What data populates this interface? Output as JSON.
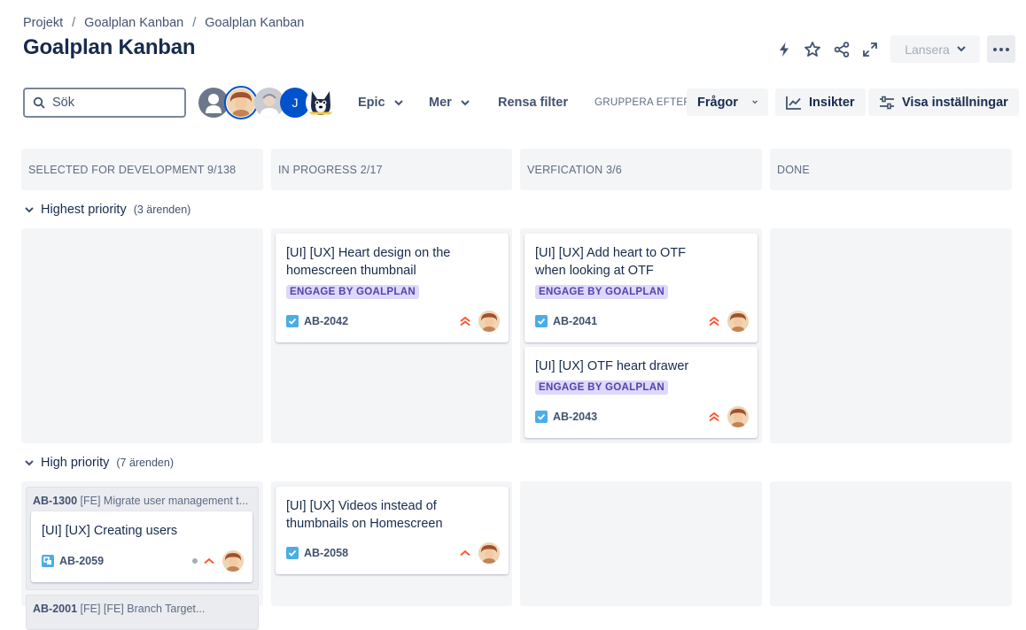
{
  "breadcrumb": [
    "Projekt",
    "Goalplan Kanban",
    "Goalplan Kanban"
  ],
  "title": "Goalplan Kanban",
  "header": {
    "release_label": "Lansera"
  },
  "toolbar": {
    "search_placeholder": "Sök",
    "avatar_j": "J",
    "epic_label": "Epic",
    "more_label": "Mer",
    "clear_filter": "Rensa filter",
    "group_by_label": "GRUPPERA EFTER",
    "group_by_value": "Frågor",
    "insights_label": "Insikter",
    "settings_label": "Visa inställningar"
  },
  "columns": [
    {
      "label": "SELECTED FOR DEVELOPMENT 9/138"
    },
    {
      "label": "IN PROGRESS 2/17"
    },
    {
      "label": "VERFICATION 3/6"
    },
    {
      "label": "DONE"
    }
  ],
  "swimlanes": [
    {
      "label": "Highest priority",
      "count": "(3 ärenden)"
    },
    {
      "label": "High priority",
      "count": "(7 ärenden)"
    }
  ],
  "cards": {
    "ab2042": {
      "title": "[UI] [UX] Heart design on the homescreen thumbnail",
      "epic": "ENGAGE BY GOALPLAN",
      "key": "AB-2042",
      "priority": "highest"
    },
    "ab2041": {
      "title": "[UI] [UX] Add heart to OTF when looking at OTF",
      "epic": "ENGAGE BY GOALPLAN",
      "key": "AB-2041",
      "priority": "highest"
    },
    "ab2043": {
      "title": "[UI] [UX] OTF heart drawer",
      "epic": "ENGAGE BY GOALPLAN",
      "key": "AB-2043",
      "priority": "highest"
    },
    "ab2058": {
      "title": "[UI] [UX] Videos instead of thumbnails on Homescreen",
      "key": "AB-2058",
      "priority": "high"
    },
    "ab2059": {
      "title": "[UI] [UX] Creating users",
      "key": "AB-2059",
      "priority": "high"
    }
  },
  "parents": [
    {
      "key": "AB-1300",
      "summary": "[FE] Migrate user management t..."
    },
    {
      "key": "AB-2001",
      "summary": "[FE] [FE] Branch Target..."
    }
  ],
  "colors": {
    "accent": "#0052cc",
    "epic_bg": "#dfd8fd",
    "epic_text": "#5243aa",
    "priority": "#ff5630",
    "story_check": "#4bade8",
    "subtask": "#4bade8"
  }
}
